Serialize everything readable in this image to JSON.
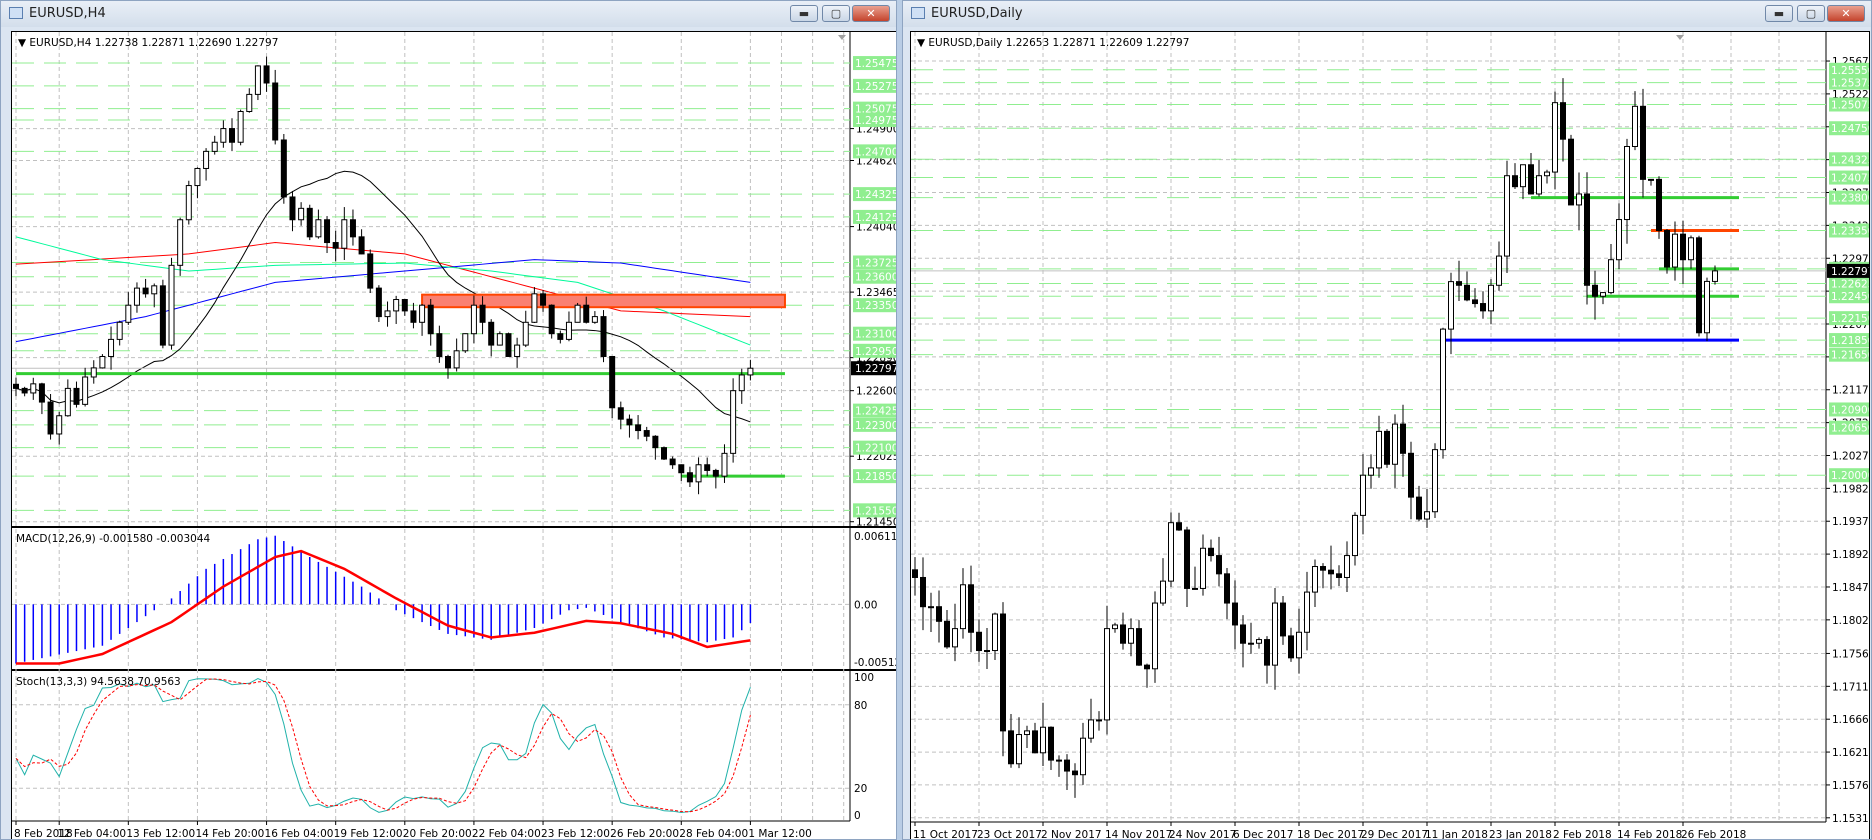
{
  "windows": {
    "h4": {
      "title": "EURUSD,H4",
      "header": "EURUSD,H4  1.22738 1.22871 1.22690 1.22797",
      "macd_label": "MACD(12,26,9) -0.001580 -0.003044",
      "stoch_label": "Stoch(13,3,3) 94.5638 70.9563",
      "price_ticks": [
        "1.24900",
        "1.24620",
        "1.24040",
        "1.23465",
        "1.22890",
        "1.22600",
        "1.22025",
        "1.21450"
      ],
      "level_labels": [
        "1.25475",
        "1.25275",
        "1.25075",
        "1.24975",
        "1.24700",
        "1.24325",
        "1.24125",
        "1.23725",
        "1.23600",
        "1.23350",
        "1.23100",
        "1.22950",
        "1.22425",
        "1.22300",
        "1.22100",
        "1.21850",
        "1.21550"
      ],
      "current_price": "1.22797",
      "macd_ticks": [
        "0.006113",
        "0.00",
        "-0.005127"
      ],
      "stoch_ticks": [
        "100",
        "80",
        "20",
        "0"
      ],
      "time_labels": [
        "8 Feb 2018",
        "12 Feb 04:00",
        "13 Feb 12:00",
        "14 Feb 20:00",
        "16 Feb 04:00",
        "19 Feb 12:00",
        "20 Feb 20:00",
        "22 Feb 04:00",
        "23 Feb 12:00",
        "26 Feb 20:00",
        "28 Feb 04:00",
        "1 Mar 12:00"
      ],
      "buttons": {
        "minimize": "▬",
        "maximize": "▢",
        "close": "✕"
      }
    },
    "daily": {
      "title": "EURUSD,Daily",
      "header": "EURUSD,Daily  1.22653 1.22871 1.22609 1.22797",
      "price_ticks": [
        "1.25670",
        "1.25220",
        "1.24770",
        "1.24320",
        "1.23870",
        "1.23420",
        "1.22970",
        "1.22520",
        "1.22070",
        "1.21620",
        "1.21170",
        "1.20720",
        "1.20270",
        "1.19820",
        "1.19370",
        "1.18920",
        "1.18470",
        "1.18020",
        "1.17560",
        "1.17110",
        "1.16660",
        "1.16210",
        "1.15760",
        "1.15310"
      ],
      "level_labels": [
        "1.25550",
        "1.25375",
        "1.25075",
        "1.24750",
        "1.24325",
        "1.24075",
        "1.23800",
        "1.23350",
        "1.22825",
        "1.22625",
        "1.22450",
        "1.22150",
        "1.21850",
        "1.21650",
        "1.20900",
        "1.20650",
        "1.20000"
      ],
      "current_price": "1.22797",
      "time_labels": [
        "11 Oct 2017",
        "23 Oct 2017",
        "2 Nov 2017",
        "14 Nov 2017",
        "24 Nov 2017",
        "6 Dec 2017",
        "18 Dec 2017",
        "29 Dec 2017",
        "11 Jan 2018",
        "23 Jan 2018",
        "2 Feb 2018",
        "14 Feb 2018",
        "26 Feb 2018"
      ],
      "buttons": {
        "minimize": "▬",
        "maximize": "▢",
        "close": "✕"
      }
    }
  },
  "colors": {
    "bull": "#ffffff",
    "bear": "#000000",
    "level_dash": "#90ee90",
    "level_label_bg": "#90ee90",
    "support": "#32cd32",
    "resistance": "#ff4500",
    "resistance_band": "#fa8072",
    "blue_line": "#0000ff",
    "ma_black": "#000000",
    "ma_red": "#ff0000",
    "ma_blue": "#0000ff",
    "ma_green": "#00fa9a",
    "macd_hist": "#0000ff",
    "macd_signal": "#ff0000",
    "stoch_main": "#20b2aa",
    "stoch_signal": "#ff0000",
    "grid": "#c0c0c0"
  },
  "chart_data": [
    {
      "type": "candlestick",
      "symbol": "EURUSD",
      "timeframe": "H4",
      "ylim": [
        1.2143,
        1.2573
      ],
      "closes": [
        1.2262,
        1.2258,
        1.2266,
        1.225,
        1.2222,
        1.2238,
        1.2262,
        1.2248,
        1.2272,
        1.228,
        1.229,
        1.2305,
        1.232,
        1.2335,
        1.235,
        1.2345,
        1.2352,
        1.23,
        1.237,
        1.241,
        1.244,
        1.2455,
        1.247,
        1.2478,
        1.249,
        1.2478,
        1.2505,
        1.252,
        1.2545,
        1.253,
        1.248,
        1.243,
        1.241,
        1.242,
        1.2395,
        1.241,
        1.239,
        1.2385,
        1.241,
        1.2395,
        1.238,
        1.235,
        1.2325,
        1.233,
        1.234,
        1.233,
        1.232,
        1.2335,
        1.231,
        1.229,
        1.228,
        1.2295,
        1.231,
        1.2335,
        1.232,
        1.23,
        1.231,
        1.229,
        1.23,
        1.232,
        1.2345,
        1.2335,
        1.231,
        1.2305,
        1.232,
        1.2335,
        1.232,
        1.2325,
        1.229,
        1.2245,
        1.2235,
        1.223,
        1.2225,
        1.222,
        1.221,
        1.22,
        1.2195,
        1.2188,
        1.218,
        1.2195,
        1.219,
        1.2185,
        1.2205,
        1.226,
        1.22738,
        1.22797
      ],
      "last_bar": {
        "open": 1.22738,
        "high": 1.22871,
        "low": 1.2269,
        "close": 1.22797
      },
      "moving_averages": {
        "red": [
          [
            0,
            1.2371
          ],
          [
            20,
            1.238
          ],
          [
            30,
            1.239
          ],
          [
            45,
            1.238
          ],
          [
            60,
            1.235
          ],
          [
            70,
            1.233
          ],
          [
            85,
            1.2325
          ]
        ],
        "blue": [
          [
            0,
            1.2303
          ],
          [
            15,
            1.2325
          ],
          [
            30,
            1.2355
          ],
          [
            45,
            1.2365
          ],
          [
            60,
            1.2375
          ],
          [
            70,
            1.2372
          ],
          [
            85,
            1.2355
          ]
        ],
        "green": [
          [
            0,
            1.2395
          ],
          [
            10,
            1.2375
          ],
          [
            20,
            1.2365
          ],
          [
            30,
            1.237
          ],
          [
            45,
            1.2372
          ],
          [
            55,
            1.2365
          ],
          [
            65,
            1.2355
          ],
          [
            75,
            1.233
          ],
          [
            85,
            1.23
          ]
        ]
      },
      "horizontal_lines": [
        {
          "kind": "support",
          "price": 1.2275,
          "from": 0,
          "to": 89
        },
        {
          "kind": "support",
          "price": 1.2185,
          "from": 77,
          "to": 89
        },
        {
          "kind": "resistance_band",
          "price_low": 1.2335,
          "price_high": 1.23425,
          "from": 47,
          "to": 89
        }
      ],
      "macd": {
        "ylim": [
          -0.005127,
          0.006113
        ],
        "histogram": [
          [
            0,
            -0.005
          ],
          [
            10,
            -0.0035
          ],
          [
            16,
            -0.0005
          ],
          [
            18,
            0.0005
          ],
          [
            22,
            0.003
          ],
          [
            28,
            0.0055
          ],
          [
            30,
            0.0058
          ],
          [
            34,
            0.004
          ],
          [
            40,
            0.0015
          ],
          [
            44,
            -0.0005
          ],
          [
            50,
            -0.0025
          ],
          [
            55,
            -0.003
          ],
          [
            60,
            -0.002
          ],
          [
            64,
            -0.0005
          ],
          [
            66,
            -0.0003
          ],
          [
            70,
            -0.0015
          ],
          [
            75,
            -0.0028
          ],
          [
            80,
            -0.0032
          ],
          [
            83,
            -0.0028
          ],
          [
            85,
            -0.00158
          ]
        ],
        "signal": [
          [
            0,
            -0.005
          ],
          [
            5,
            -0.005
          ],
          [
            10,
            -0.0042
          ],
          [
            18,
            -0.0015
          ],
          [
            24,
            0.0015
          ],
          [
            30,
            0.004
          ],
          [
            33,
            0.0045
          ],
          [
            38,
            0.003
          ],
          [
            44,
            0.0005
          ],
          [
            50,
            -0.0018
          ],
          [
            55,
            -0.0028
          ],
          [
            60,
            -0.0024
          ],
          [
            66,
            -0.0014
          ],
          [
            70,
            -0.0016
          ],
          [
            76,
            -0.0025
          ],
          [
            80,
            -0.0036
          ],
          [
            85,
            -0.003044
          ]
        ]
      },
      "stochastic": {
        "ylim": [
          0,
          100
        ],
        "levels": [
          20,
          80
        ]
      }
    },
    {
      "type": "candlestick",
      "symbol": "EURUSD",
      "timeframe": "Daily",
      "ylim": [
        1.1528,
        1.2604
      ],
      "closes": [
        1.186,
        1.182,
        1.182,
        1.18,
        1.1765,
        1.179,
        1.185,
        1.1785,
        1.176,
        1.176,
        1.181,
        1.165,
        1.1605,
        1.1645,
        1.165,
        1.162,
        1.1655,
        1.161,
        1.161,
        1.1595,
        1.159,
        1.164,
        1.1665,
        1.1665,
        1.179,
        1.1795,
        1.177,
        1.179,
        1.174,
        1.1735,
        1.1825,
        1.1855,
        1.1935,
        1.1925,
        1.1845,
        1.1845,
        1.19,
        1.189,
        1.1865,
        1.1825,
        1.1795,
        1.177,
        1.177,
        1.1775,
        1.174,
        1.1825,
        1.178,
        1.175,
        1.1785,
        1.184,
        1.1875,
        1.187,
        1.1865,
        1.186,
        1.189,
        1.1945,
        1.2,
        1.201,
        1.206,
        1.2015,
        1.207,
        1.203,
        1.197,
        1.194,
        1.195,
        1.2035,
        1.22,
        1.2265,
        1.226,
        1.224,
        1.2235,
        1.2225,
        1.226,
        1.23,
        1.241,
        1.2395,
        1.2425,
        1.2385,
        1.241,
        1.2415,
        1.251,
        1.246,
        1.237,
        1.2385,
        1.226,
        1.2245,
        1.225,
        1.2295,
        1.235,
        1.245,
        1.2505,
        1.2405,
        1.2405,
        1.2335,
        1.2285,
        1.233,
        1.2295,
        1.2325,
        1.2195,
        1.22653,
        1.22797
      ],
      "last_bar": {
        "open": 1.22653,
        "high": 1.22871,
        "low": 1.22609,
        "close": 1.22797
      },
      "horizontal_lines": [
        {
          "kind": "support",
          "price": 1.238,
          "from": 77,
          "to": 103
        },
        {
          "kind": "resistance",
          "price": 1.2335,
          "from": 92,
          "to": 103
        },
        {
          "kind": "support",
          "price": 1.22825,
          "from": 93,
          "to": 103
        },
        {
          "kind": "support",
          "price": 1.2245,
          "from": 84,
          "to": 103
        },
        {
          "kind": "blue_line",
          "price": 1.2185,
          "from": 66,
          "to": 103
        }
      ]
    }
  ]
}
